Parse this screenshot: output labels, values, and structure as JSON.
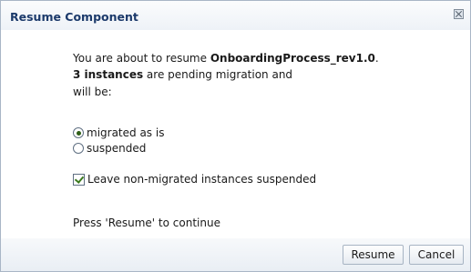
{
  "dialog": {
    "title": "Resume Component",
    "message": {
      "prefix": "You are about to resume ",
      "component": "OnboardingProcess_rev1.0",
      "suffix": ".",
      "instances_bold": "3 instances",
      "pending_text": " are pending migration and",
      "will_be": "will be:"
    },
    "options": [
      {
        "label": "migrated as is",
        "selected": true
      },
      {
        "label": "suspended",
        "selected": false
      }
    ],
    "checkbox": {
      "label": "Leave non-migrated instances suspended",
      "checked": true
    },
    "instruction": "Press 'Resume' to continue",
    "buttons": {
      "resume": "Resume",
      "cancel": "Cancel"
    }
  }
}
